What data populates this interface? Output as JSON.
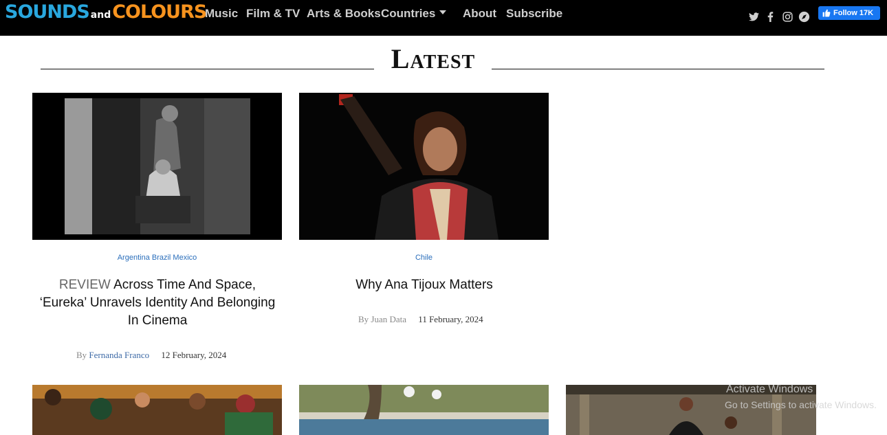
{
  "brand": {
    "logo_part1": "SOUNDS",
    "logo_part2": "and",
    "logo_part3": "COLOURS"
  },
  "nav": {
    "music": "Music",
    "film_tv": "Film & TV",
    "arts_books": "Arts & Books",
    "countries": "Countries",
    "about": "About",
    "subscribe": "Subscribe"
  },
  "social": {
    "icons": [
      "twitter-icon",
      "facebook-icon",
      "instagram-icon",
      "mixcloud-icon"
    ],
    "facebook_follow": "Follow 17K"
  },
  "section": {
    "title": "Latest"
  },
  "articles": [
    {
      "categories": "Argentina Brazil Mexico",
      "tag": "REVIEW",
      "title": "Across Time And Space, ‘Eureka’ Unravels Identity And Belonging In Cinema",
      "by": "By",
      "author": "Fernanda Franco",
      "date": "12 February, 2024"
    },
    {
      "categories": "Chile",
      "title": "Why Ana Tijoux Matters",
      "by": "By",
      "author": "Juan Data",
      "date": "11 February, 2024"
    }
  ],
  "watermark": {
    "line1": "Activate Windows",
    "line2": "Go to Settings to activate Windows."
  },
  "colors": {
    "topbar": "#000000",
    "logo_blue": "#29a7de",
    "logo_orange": "#f7931e",
    "link_blue": "#2a6ebb",
    "facebook": "#1877f2"
  }
}
